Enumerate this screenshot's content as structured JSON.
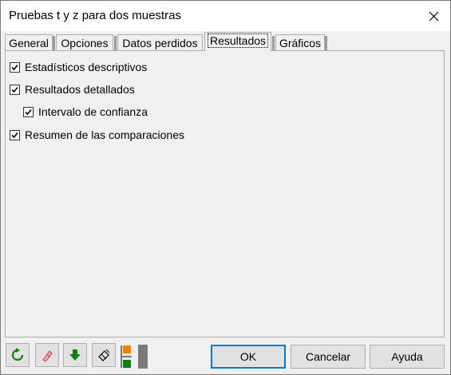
{
  "window": {
    "title": "Pruebas t y z para dos muestras"
  },
  "tabs": [
    {
      "label": "General",
      "active": false
    },
    {
      "label": "Opciones",
      "active": false
    },
    {
      "label": "Datos perdidos",
      "active": false
    },
    {
      "label": "Resultados",
      "active": true
    },
    {
      "label": "Gráficos",
      "active": false
    }
  ],
  "options": [
    {
      "label": "Estadísticos descriptivos",
      "checked": true
    },
    {
      "label": "Resultados detallados",
      "checked": true
    },
    {
      "label": "Intervalo de confianza",
      "checked": true
    },
    {
      "label": "Resumen de las comparaciones",
      "checked": true
    }
  ],
  "toolbar": {
    "icons": [
      "reset-icon",
      "eraser-icon",
      "download-arrow-icon",
      "clear-selection-icon",
      "layout-toggle-icon"
    ]
  },
  "buttons": {
    "ok": "OK",
    "cancel": "Cancelar",
    "help": "Ayuda"
  },
  "colors": {
    "accent": "#0078d7",
    "orange": "#ff8000",
    "green": "#008000"
  }
}
